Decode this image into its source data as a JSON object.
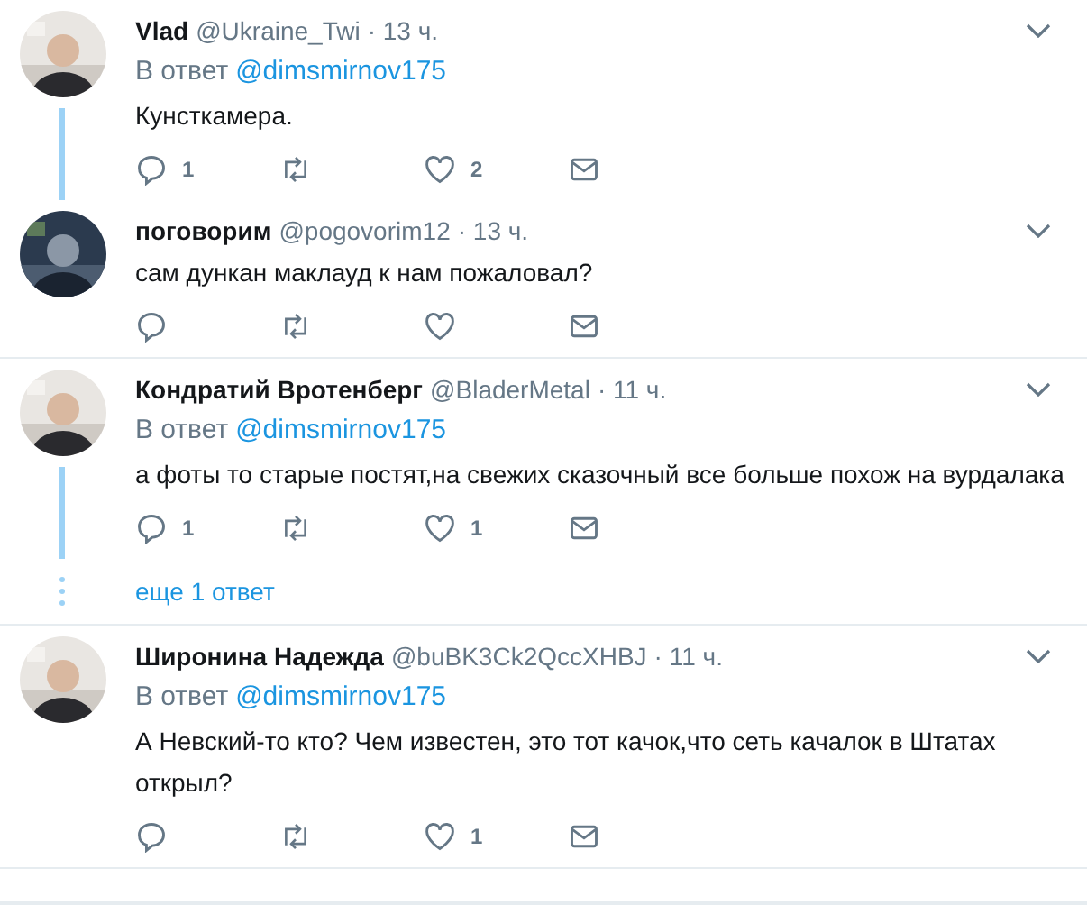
{
  "tweets": [
    {
      "name": "Vlad",
      "handle": "@Ukraine_Twi",
      "time": "· 13 ч.",
      "reply_label": "В ответ",
      "reply_to": "@dimsmirnov175",
      "text": "Кунсткамера.",
      "reply_count": "1",
      "like_count": "2",
      "thread_line": true
    },
    {
      "name": "поговорим",
      "handle": "@pogovorim12",
      "time": "· 13 ч.",
      "text": "сам дункан маклауд к нам пожаловал?",
      "thread_line": false
    },
    {
      "name": "Кондратий Вротенберг",
      "handle": "@BladerMetal",
      "time": "· 11 ч.",
      "reply_label": "В ответ",
      "reply_to": "@dimsmirnov175",
      "text": "а фоты то старые постят,на свежих сказочный все больше похож на вурдалака",
      "reply_count": "1",
      "like_count": "1",
      "thread_line": true,
      "more_replies": "еще 1 ответ"
    },
    {
      "name": "Широнина Надежда",
      "handle": "@buBK3Ck2QccXHBJ",
      "time": "· 11 ч.",
      "reply_label": "В ответ",
      "reply_to": "@dimsmirnov175",
      "text": "А Невский-то кто? Чем известен, это тот качок,что сеть качалок в Штатах открыл?",
      "like_count": "1",
      "thread_line": false
    }
  ]
}
